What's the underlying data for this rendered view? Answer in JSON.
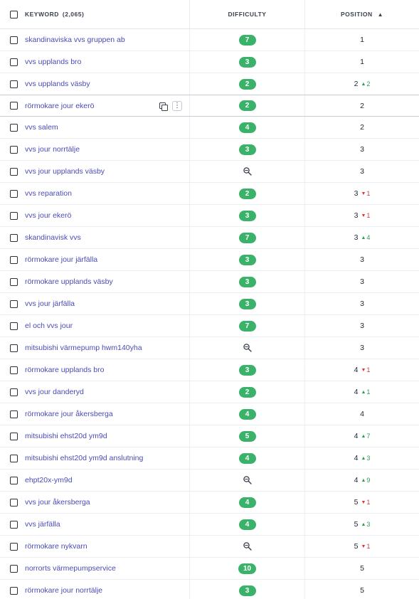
{
  "header": {
    "keyword_label": "KEYWORD",
    "keyword_count": "(2,065)",
    "difficulty_label": "DIFFICULTY",
    "position_label": "POSITION",
    "sort_icon": "▲"
  },
  "colors": {
    "difficulty_badge": "#3bb26a",
    "link": "#4a4bb5",
    "change_up": "#2f9a52",
    "change_down": "#d63a3a"
  },
  "rows": [
    {
      "keyword": "skandinaviska vvs gruppen ab",
      "difficulty": "7",
      "position": "1",
      "change": "",
      "dir": ""
    },
    {
      "keyword": "vvs upplands bro",
      "difficulty": "3",
      "position": "1",
      "change": "",
      "dir": ""
    },
    {
      "keyword": "vvs upplands väsby",
      "difficulty": "2",
      "position": "2",
      "change": "2",
      "dir": "up"
    },
    {
      "keyword": "rörmokare jour ekerö",
      "difficulty": "2",
      "position": "2",
      "change": "",
      "dir": "",
      "hover": true
    },
    {
      "keyword": "vvs salem",
      "difficulty": "4",
      "position": "2",
      "change": "",
      "dir": ""
    },
    {
      "keyword": "vvs jour norrtälje",
      "difficulty": "3",
      "position": "3",
      "change": "",
      "dir": ""
    },
    {
      "keyword": "vvs jour upplands väsby",
      "difficulty": "",
      "position": "3",
      "change": "",
      "dir": ""
    },
    {
      "keyword": "vvs reparation",
      "difficulty": "2",
      "position": "3",
      "change": "1",
      "dir": "down"
    },
    {
      "keyword": "vvs jour ekerö",
      "difficulty": "3",
      "position": "3",
      "change": "1",
      "dir": "down"
    },
    {
      "keyword": "skandinavisk vvs",
      "difficulty": "7",
      "position": "3",
      "change": "4",
      "dir": "up"
    },
    {
      "keyword": "rörmokare jour järfälla",
      "difficulty": "3",
      "position": "3",
      "change": "",
      "dir": ""
    },
    {
      "keyword": "rörmokare upplands väsby",
      "difficulty": "3",
      "position": "3",
      "change": "",
      "dir": ""
    },
    {
      "keyword": "vvs jour järfälla",
      "difficulty": "3",
      "position": "3",
      "change": "",
      "dir": ""
    },
    {
      "keyword": "el och vvs jour",
      "difficulty": "7",
      "position": "3",
      "change": "",
      "dir": ""
    },
    {
      "keyword": "mitsubishi värmepump hwm140yha",
      "difficulty": "",
      "position": "3",
      "change": "",
      "dir": ""
    },
    {
      "keyword": "rörmokare upplands bro",
      "difficulty": "3",
      "position": "4",
      "change": "1",
      "dir": "down"
    },
    {
      "keyword": "vvs jour danderyd",
      "difficulty": "2",
      "position": "4",
      "change": "1",
      "dir": "up"
    },
    {
      "keyword": "rörmokare jour åkersberga",
      "difficulty": "4",
      "position": "4",
      "change": "",
      "dir": ""
    },
    {
      "keyword": "mitsubishi ehst20d ym9d",
      "difficulty": "5",
      "position": "4",
      "change": "7",
      "dir": "up"
    },
    {
      "keyword": "mitsubishi ehst20d ym9d anslutning",
      "difficulty": "4",
      "position": "4",
      "change": "3",
      "dir": "up"
    },
    {
      "keyword": "ehpt20x-ym9d",
      "difficulty": "",
      "position": "4",
      "change": "9",
      "dir": "up"
    },
    {
      "keyword": "vvs jour åkersberga",
      "difficulty": "4",
      "position": "5",
      "change": "1",
      "dir": "down"
    },
    {
      "keyword": "vvs järfälla",
      "difficulty": "4",
      "position": "5",
      "change": "3",
      "dir": "up"
    },
    {
      "keyword": "rörmokare nykvarn",
      "difficulty": "",
      "position": "5",
      "change": "1",
      "dir": "down"
    },
    {
      "keyword": "norrorts värmepumpservice",
      "difficulty": "10",
      "position": "5",
      "change": "",
      "dir": ""
    },
    {
      "keyword": "rörmokare jour norrtälje",
      "difficulty": "3",
      "position": "5",
      "change": "",
      "dir": ""
    }
  ]
}
